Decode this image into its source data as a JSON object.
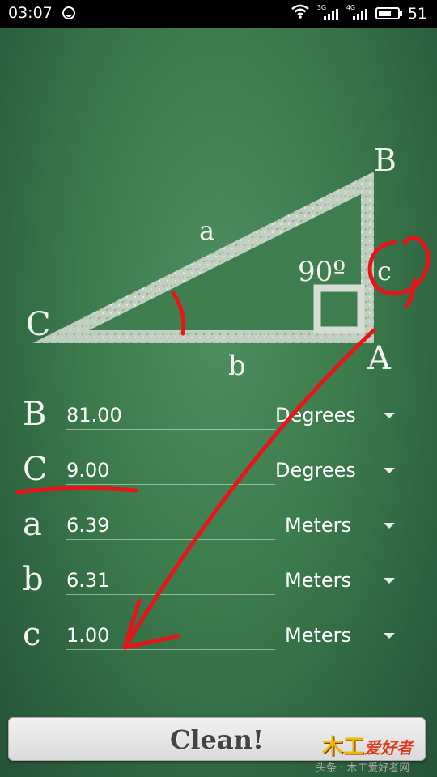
{
  "status_bar": {
    "time": "03:07",
    "signal1_label": "3G",
    "signal2_label": "4G",
    "battery": "51"
  },
  "diagram": {
    "vertex_B": "B",
    "vertex_C": "C",
    "vertex_A": "A",
    "side_a": "a",
    "side_b": "b",
    "side_c": "c",
    "right_angle": "90º"
  },
  "rows": [
    {
      "symbol": "B",
      "value": "81.00",
      "unit": "Degrees"
    },
    {
      "symbol": "C",
      "value": "9.00",
      "unit": "Degrees"
    },
    {
      "symbol": "a",
      "value": "6.39",
      "unit": "Meters"
    },
    {
      "symbol": "b",
      "value": "6.31",
      "unit": "Meters"
    },
    {
      "symbol": "c",
      "value": "1.00",
      "unit": "Meters"
    }
  ],
  "clean_button": {
    "label": "Clean!"
  },
  "watermark": {
    "logo_left": "木工",
    "logo_right": "爱好者",
    "caption": "头条 · 木工爱好者网"
  },
  "colors": {
    "chalkboard": "#3b7a4b",
    "annotation": "#e8141a"
  }
}
